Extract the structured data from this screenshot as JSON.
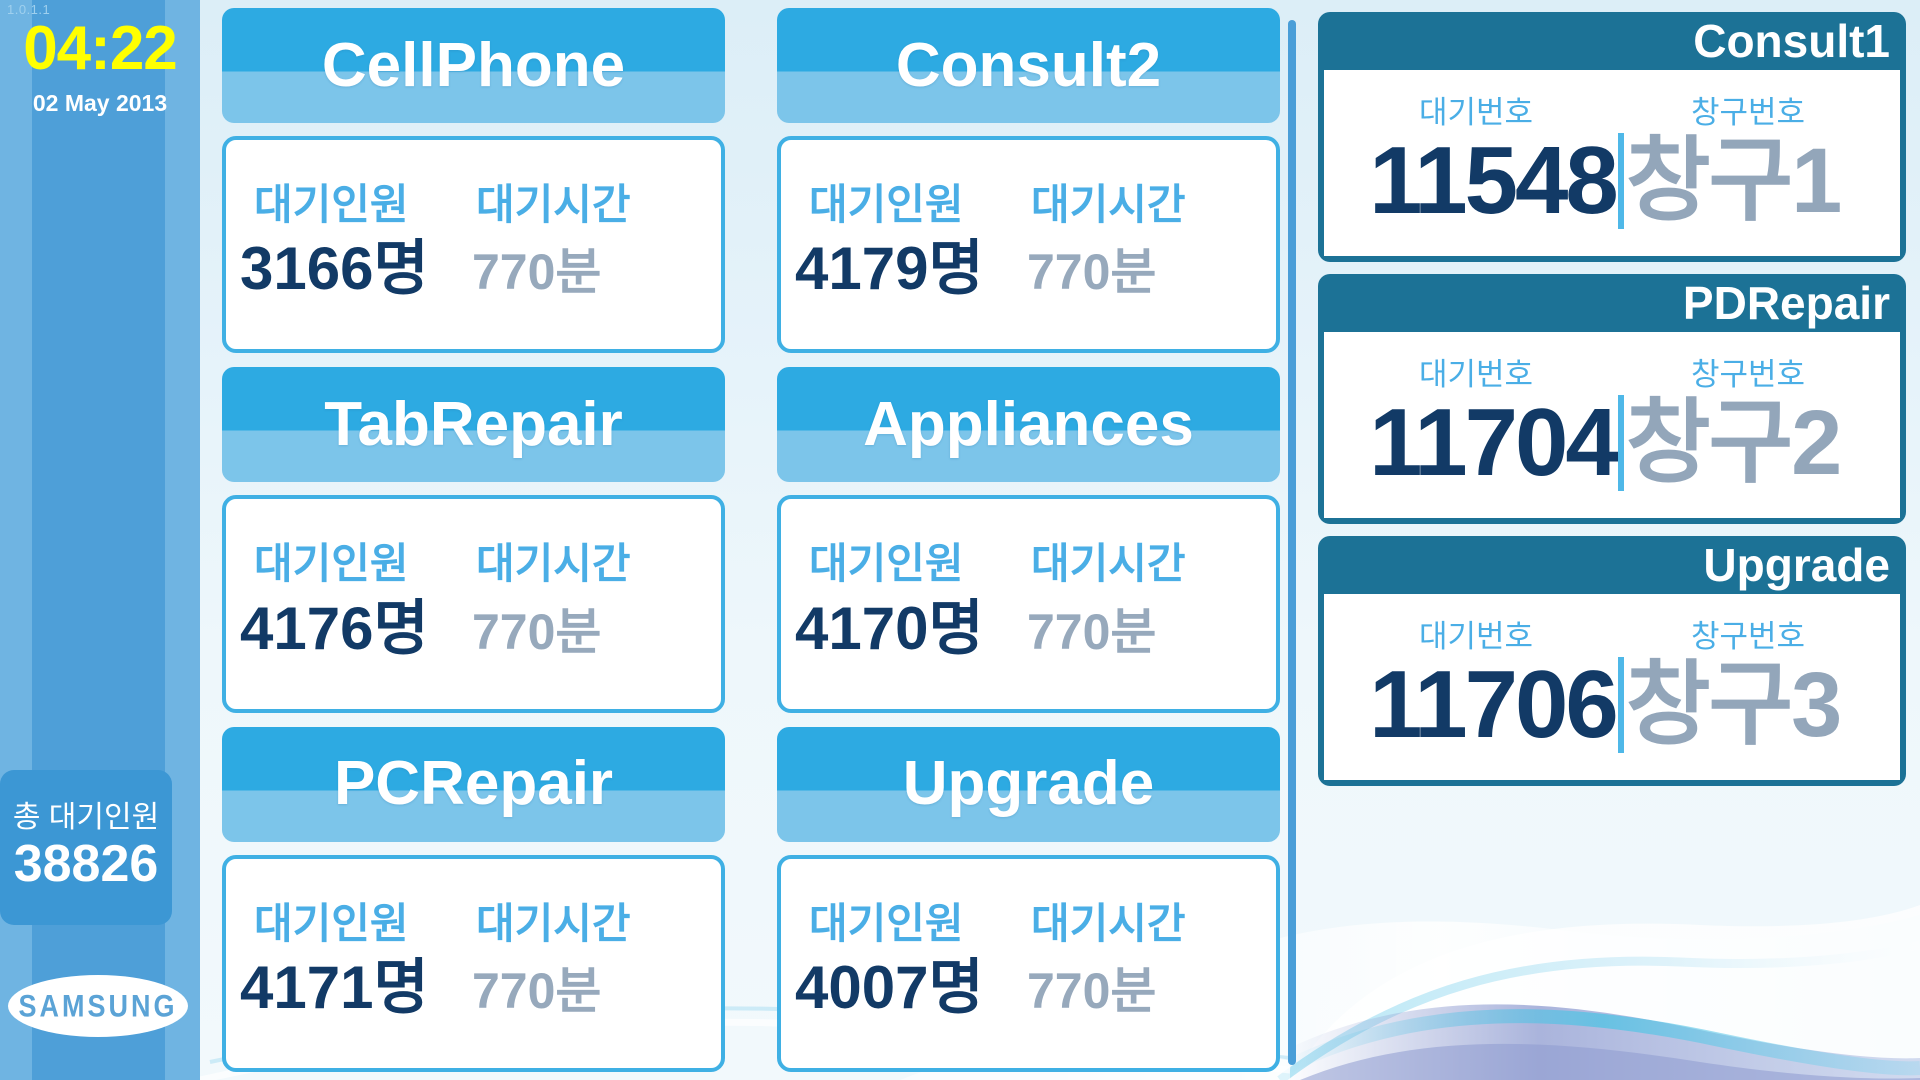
{
  "sidebar": {
    "version": "1.0.1.1",
    "clock_time": "04:22",
    "clock_date": "02 May 2013",
    "total_label": "총 대기인원",
    "total_value": "38826",
    "brand": "SAMSUNG"
  },
  "labels": {
    "waiting_people": "대기인원",
    "waiting_time": "대기시간",
    "ticket_number": "대기번호",
    "window_number": "창구번호"
  },
  "services": [
    {
      "name": "CellPhone",
      "people": "3166명",
      "time": "770분"
    },
    {
      "name": "Consult2",
      "people": "4179명",
      "time": "770분"
    },
    {
      "name": "TabRepair",
      "people": "4176명",
      "time": "770분"
    },
    {
      "name": "Appliances",
      "people": "4170명",
      "time": "770분"
    },
    {
      "name": "PCRepair",
      "people": "4171명",
      "time": "770분"
    },
    {
      "name": "Upgrade",
      "people": "4007명",
      "time": "770분"
    }
  ],
  "counters": [
    {
      "service": "Consult1",
      "ticket": "11548",
      "window": "창구1"
    },
    {
      "service": "PDRepair",
      "ticket": "11704",
      "window": "창구2"
    },
    {
      "service": "Upgrade",
      "ticket": "11706",
      "window": "창구3"
    }
  ],
  "colors": {
    "accent_blue": "#2daae2",
    "light_blue": "#7cc5ea",
    "dark_navy": "#123a66",
    "teal_frame": "#1c7296",
    "gray_value": "#97a9bc",
    "clock_yellow": "#ffff00",
    "sidebar_blue": "#4e9fd8"
  }
}
